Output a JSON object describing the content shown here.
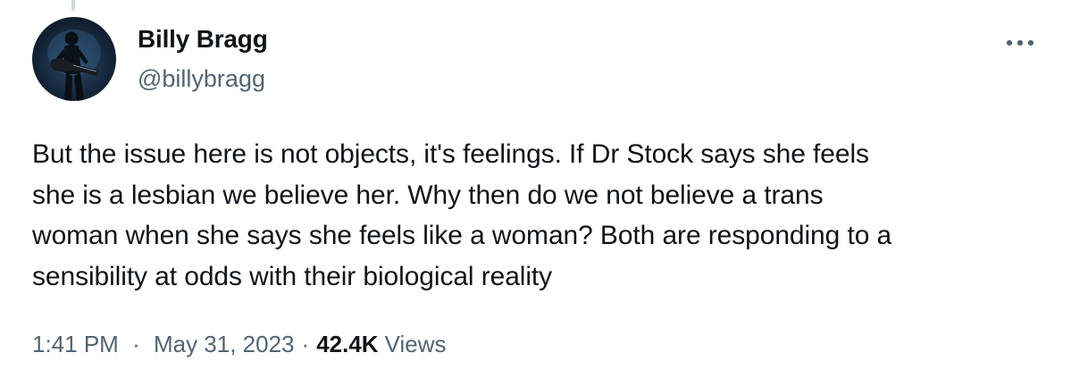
{
  "tweet": {
    "author": {
      "display_name": "Billy Bragg",
      "handle": "@billybragg",
      "avatar_icon": "user-avatar-photo"
    },
    "text_lines": [
      "But the issue here is not objects, it's feelings. If Dr Stock says she feels",
      "she is a lesbian we believe her. Why then do we not believe a trans",
      "woman when she says she feels like a woman? Both are responding to a",
      "sensibility at odds with their biological reality"
    ],
    "time": "1:41 PM",
    "date": "May 31, 2023",
    "separator": "·",
    "views_count": "42.4K",
    "views_label": "Views",
    "more_icon": "more-options-icon"
  },
  "colors": {
    "text_primary": "#0f1419",
    "text_secondary": "#536471",
    "thread_line": "#cfd9de",
    "background": "#ffffff"
  }
}
